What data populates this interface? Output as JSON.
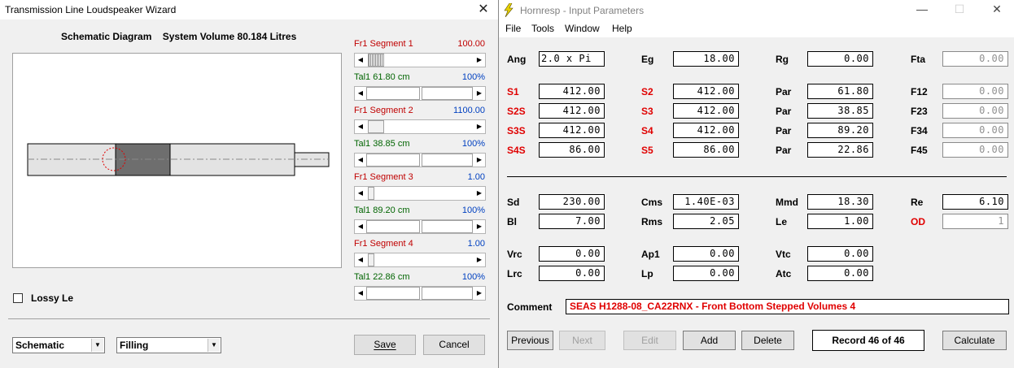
{
  "wizard": {
    "title": "Transmission Line Loudspeaker Wizard",
    "schematic_title": "Schematic Diagram",
    "system_volume": "System Volume 80.184 Litres",
    "sliders": [
      {
        "label": "Fr1  Segment 1",
        "value": "100.00",
        "value_color": "red"
      },
      {
        "label": "Tal1  61.80 cm",
        "value": "100%",
        "value_color": "blue"
      },
      {
        "label": "Fr1  Segment 2",
        "value": "1100.00",
        "value_color": "blue"
      },
      {
        "label": "Tal1  38.85 cm",
        "value": "100%",
        "value_color": "blue"
      },
      {
        "label": "Fr1  Segment 3",
        "value": "1.00",
        "value_color": "blue"
      },
      {
        "label": "Tal1  89.20 cm",
        "value": "100%",
        "value_color": "blue"
      },
      {
        "label": "Fr1  Segment 4",
        "value": "1.00",
        "value_color": "blue"
      },
      {
        "label": "Tal1  22.86 cm",
        "value": "100%",
        "value_color": "blue"
      }
    ],
    "lossy_le": "Lossy Le",
    "view_select": "Schematic",
    "fill_select": "Filling",
    "save_label": "Save",
    "cancel_label": "Cancel"
  },
  "hornresp": {
    "title": "Hornresp - Input Parameters",
    "menu": [
      "File",
      "Tools",
      "Window",
      "Help"
    ],
    "row_ang": [
      {
        "label": "Ang",
        "value": "2.0 x Pi"
      },
      {
        "label": "Eg",
        "value": "18.00"
      },
      {
        "label": "Rg",
        "value": "0.00"
      },
      {
        "label": "Fta",
        "value": "0.00"
      }
    ],
    "segments": [
      [
        {
          "label": "S1",
          "value": "412.00"
        },
        {
          "label": "S2",
          "value": "412.00"
        },
        {
          "label": "Par",
          "value": "61.80"
        },
        {
          "label": "F12",
          "value": "0.00"
        }
      ],
      [
        {
          "label": "S2S",
          "value": "412.00"
        },
        {
          "label": "S3",
          "value": "412.00"
        },
        {
          "label": "Par",
          "value": "38.85"
        },
        {
          "label": "F23",
          "value": "0.00"
        }
      ],
      [
        {
          "label": "S3S",
          "value": "412.00"
        },
        {
          "label": "S4",
          "value": "412.00"
        },
        {
          "label": "Par",
          "value": "89.20"
        },
        {
          "label": "F34",
          "value": "0.00"
        }
      ],
      [
        {
          "label": "S4S",
          "value": "86.00"
        },
        {
          "label": "S5",
          "value": "86.00"
        },
        {
          "label": "Par",
          "value": "22.86"
        },
        {
          "label": "F45",
          "value": "0.00"
        }
      ]
    ],
    "driver": [
      [
        {
          "label": "Sd",
          "value": "230.00"
        },
        {
          "label": "Cms",
          "value": "1.40E-03"
        },
        {
          "label": "Mmd",
          "value": "18.30"
        },
        {
          "label": "Re",
          "value": "6.10"
        }
      ],
      [
        {
          "label": "Bl",
          "value": "7.00"
        },
        {
          "label": "Rms",
          "value": "2.05"
        },
        {
          "label": "Le",
          "value": "1.00"
        },
        {
          "label": "OD",
          "value": "1"
        }
      ]
    ],
    "chambers": [
      [
        {
          "label": "Vrc",
          "value": "0.00"
        },
        {
          "label": "Ap1",
          "value": "0.00"
        },
        {
          "label": "Vtc",
          "value": "0.00"
        }
      ],
      [
        {
          "label": "Lrc",
          "value": "0.00"
        },
        {
          "label": "Lp",
          "value": "0.00"
        },
        {
          "label": "Atc",
          "value": "0.00"
        }
      ]
    ],
    "comment_label": "Comment",
    "comment_value": "SEAS H1288-08_CA22RNX - Front Bottom Stepped Volumes 4",
    "buttons": {
      "previous": "Previous",
      "next": "Next",
      "edit": "Edit",
      "add": "Add",
      "delete": "Delete",
      "record": "Record 46 of 46",
      "calculate": "Calculate"
    }
  }
}
